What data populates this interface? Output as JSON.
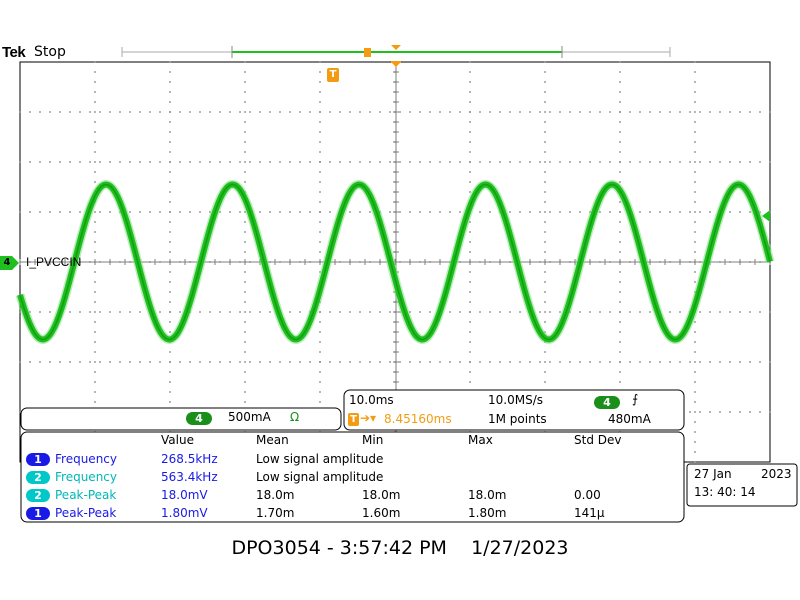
{
  "header": {
    "brand": "Tek",
    "run_state": "Stop"
  },
  "trigger_marker": "T",
  "channel": {
    "number": "4",
    "label": "I_PVCCIN",
    "color": "#1fbf1f",
    "scale": "500mA",
    "coupling": "Ω"
  },
  "timebase": {
    "time_per_div": "10.0ms",
    "sample_rate": "10.0MS/s",
    "trigger_pos": "8.45160ms",
    "record_length": "1M points",
    "trigger_channel": "4",
    "trigger_slope": "⨍",
    "trigger_level": "480mA"
  },
  "measurements": {
    "headers": [
      "Value",
      "Mean",
      "Min",
      "Max",
      "Std Dev"
    ],
    "rows": [
      {
        "ch": "1",
        "ch_color": "#1a1ae6",
        "name": "Frequency",
        "name_color": "#1a1ae6",
        "value": "268.5kHz",
        "note": "Low signal amplitude",
        "mean": "",
        "min": "",
        "max": "",
        "std": ""
      },
      {
        "ch": "2",
        "ch_color": "#00c8c8",
        "name": "Frequency",
        "name_color": "#00b7b7",
        "value": "563.4kHz",
        "note": "Low signal amplitude",
        "mean": "",
        "min": "",
        "max": "",
        "std": ""
      },
      {
        "ch": "2",
        "ch_color": "#00c8c8",
        "name": "Peak-Peak",
        "name_color": "#00b7b7",
        "value": "18.0mV",
        "note": "",
        "mean": "18.0m",
        "min": "18.0m",
        "max": "18.0m",
        "std": "0.00"
      },
      {
        "ch": "1",
        "ch_color": "#1a1ae6",
        "name": "Peak-Peak",
        "name_color": "#1a1ae6",
        "value": "1.80mV",
        "note": "",
        "mean": "1.70m",
        "min": "1.60m",
        "max": "1.80m",
        "std": "141µ"
      }
    ]
  },
  "datetime": {
    "date_day": "27 Jan",
    "date_year": "2023",
    "time": "13: 40: 14"
  },
  "footer": "DPO3054 - 3:57:42 PM    1/27/2023",
  "colors": {
    "trace": "#1fbf1f",
    "grid": "#7f7f7f",
    "trigger": "#f39c12",
    "ch1": "#1a1ae6",
    "ch2": "#00c8c8"
  },
  "waveform": {
    "cycles_on_screen": 5.93,
    "amplitude_divs": 1.55,
    "phase_at_left_deg": 205
  }
}
